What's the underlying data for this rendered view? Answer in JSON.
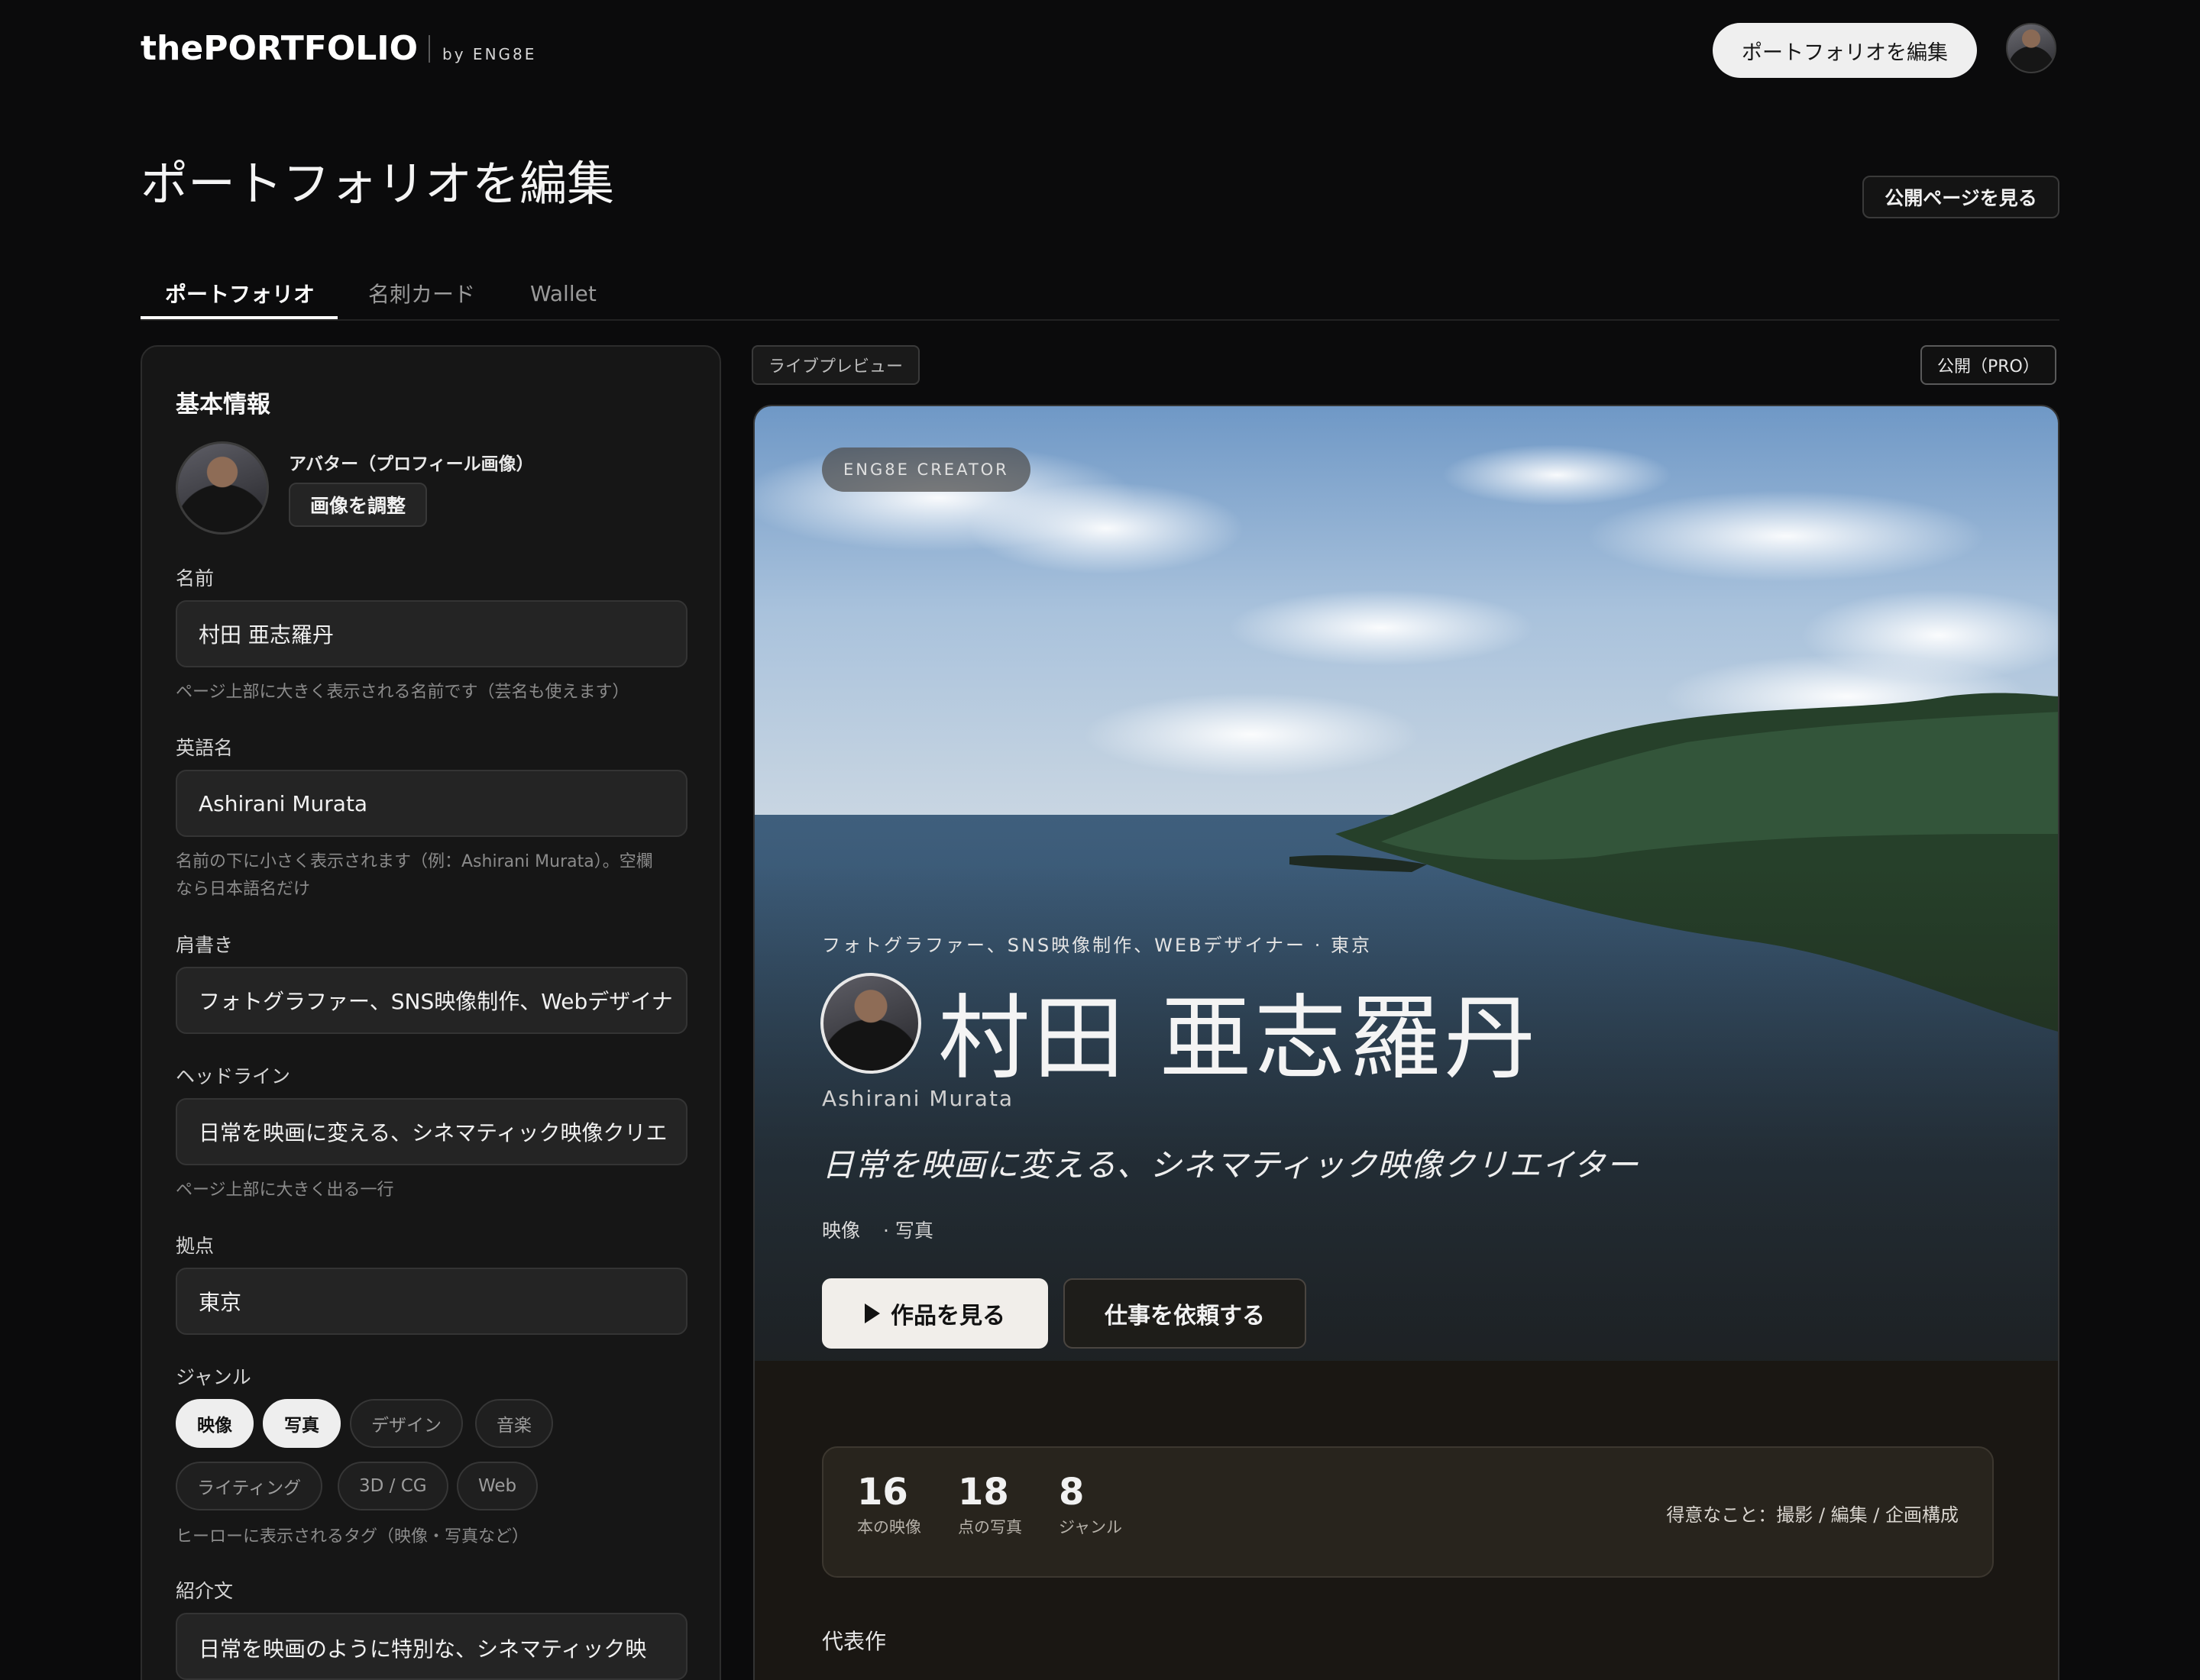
{
  "header": {
    "logo": "thePORTFOLIO",
    "logo_by": "by ENG8E",
    "edit_button": "ポートフォリオを編集"
  },
  "page": {
    "title": "ポートフォリオを編集",
    "view_public_button": "公開ページを見る"
  },
  "tabs": [
    {
      "label": "ポートフォリオ",
      "active": true
    },
    {
      "label": "名刺カード",
      "active": false
    },
    {
      "label": "Wallet",
      "active": false
    }
  ],
  "form": {
    "section_title": "基本情報",
    "avatar_label": "アバター（プロフィール画像）",
    "adjust_button": "画像を調整",
    "name_label": "名前",
    "name_value": "村田 亜志羅丹",
    "name_help": "ページ上部に大きく表示される名前です（芸名も使えます）",
    "english_label": "英語名",
    "english_value": "Ashirani Murata",
    "english_help_1": "名前の下に小さく表示されます（例：Ashirani Murata）。空欄",
    "english_help_2": "なら日本語名だけ",
    "title_label": "肩書き",
    "title_value": "フォトグラファー、SNS映像制作、Webデザイナ",
    "headline_label": "ヘッドライン",
    "headline_value": "日常を映画に変える、シネマティック映像クリエ",
    "headline_help": "ページ上部に大きく出る一行",
    "base_label": "拠点",
    "base_value": "東京",
    "genre_label": "ジャンル",
    "genres": [
      {
        "label": "映像",
        "selected": true
      },
      {
        "label": "写真",
        "selected": true
      },
      {
        "label": "デザイン",
        "selected": false
      },
      {
        "label": "音楽",
        "selected": false
      },
      {
        "label": "ライティング",
        "selected": false
      },
      {
        "label": "3D / CG",
        "selected": false
      },
      {
        "label": "Web",
        "selected": false
      }
    ],
    "genre_help": "ヒーローに表示されるタグ（映像・写真など）",
    "intro_label": "紹介文",
    "intro_value": "日常を映画のように特別な、シネマティック映"
  },
  "preview": {
    "tag": "ライブプレビュー",
    "status": "公開（PRO）",
    "badge": "ENG8E CREATOR",
    "role_line": "フォトグラファー、SNS映像制作、WEBデザイナー · 東京",
    "name": "村田 亜志羅丹",
    "english_name": "Ashirani Murata",
    "headline": "日常を映画に変える、シネマティック映像クリエイター",
    "genre_1": "映像",
    "genre_2": "· 写真",
    "primary_button": "作品を見る",
    "secondary_button": "仕事を依頼する",
    "stats": [
      {
        "num": "16",
        "label": "本の映像"
      },
      {
        "num": "18",
        "label": "点の写真"
      },
      {
        "num": "8",
        "label": "ジャンル"
      }
    ],
    "strengths": "得意なこと：撮影 / 編集 / 企画構成",
    "works_heading": "代表作"
  },
  "colors": {
    "background": "#0b0b0c",
    "panel": "#161616",
    "accent_light": "#efefef",
    "stats_card": "#28241d"
  }
}
